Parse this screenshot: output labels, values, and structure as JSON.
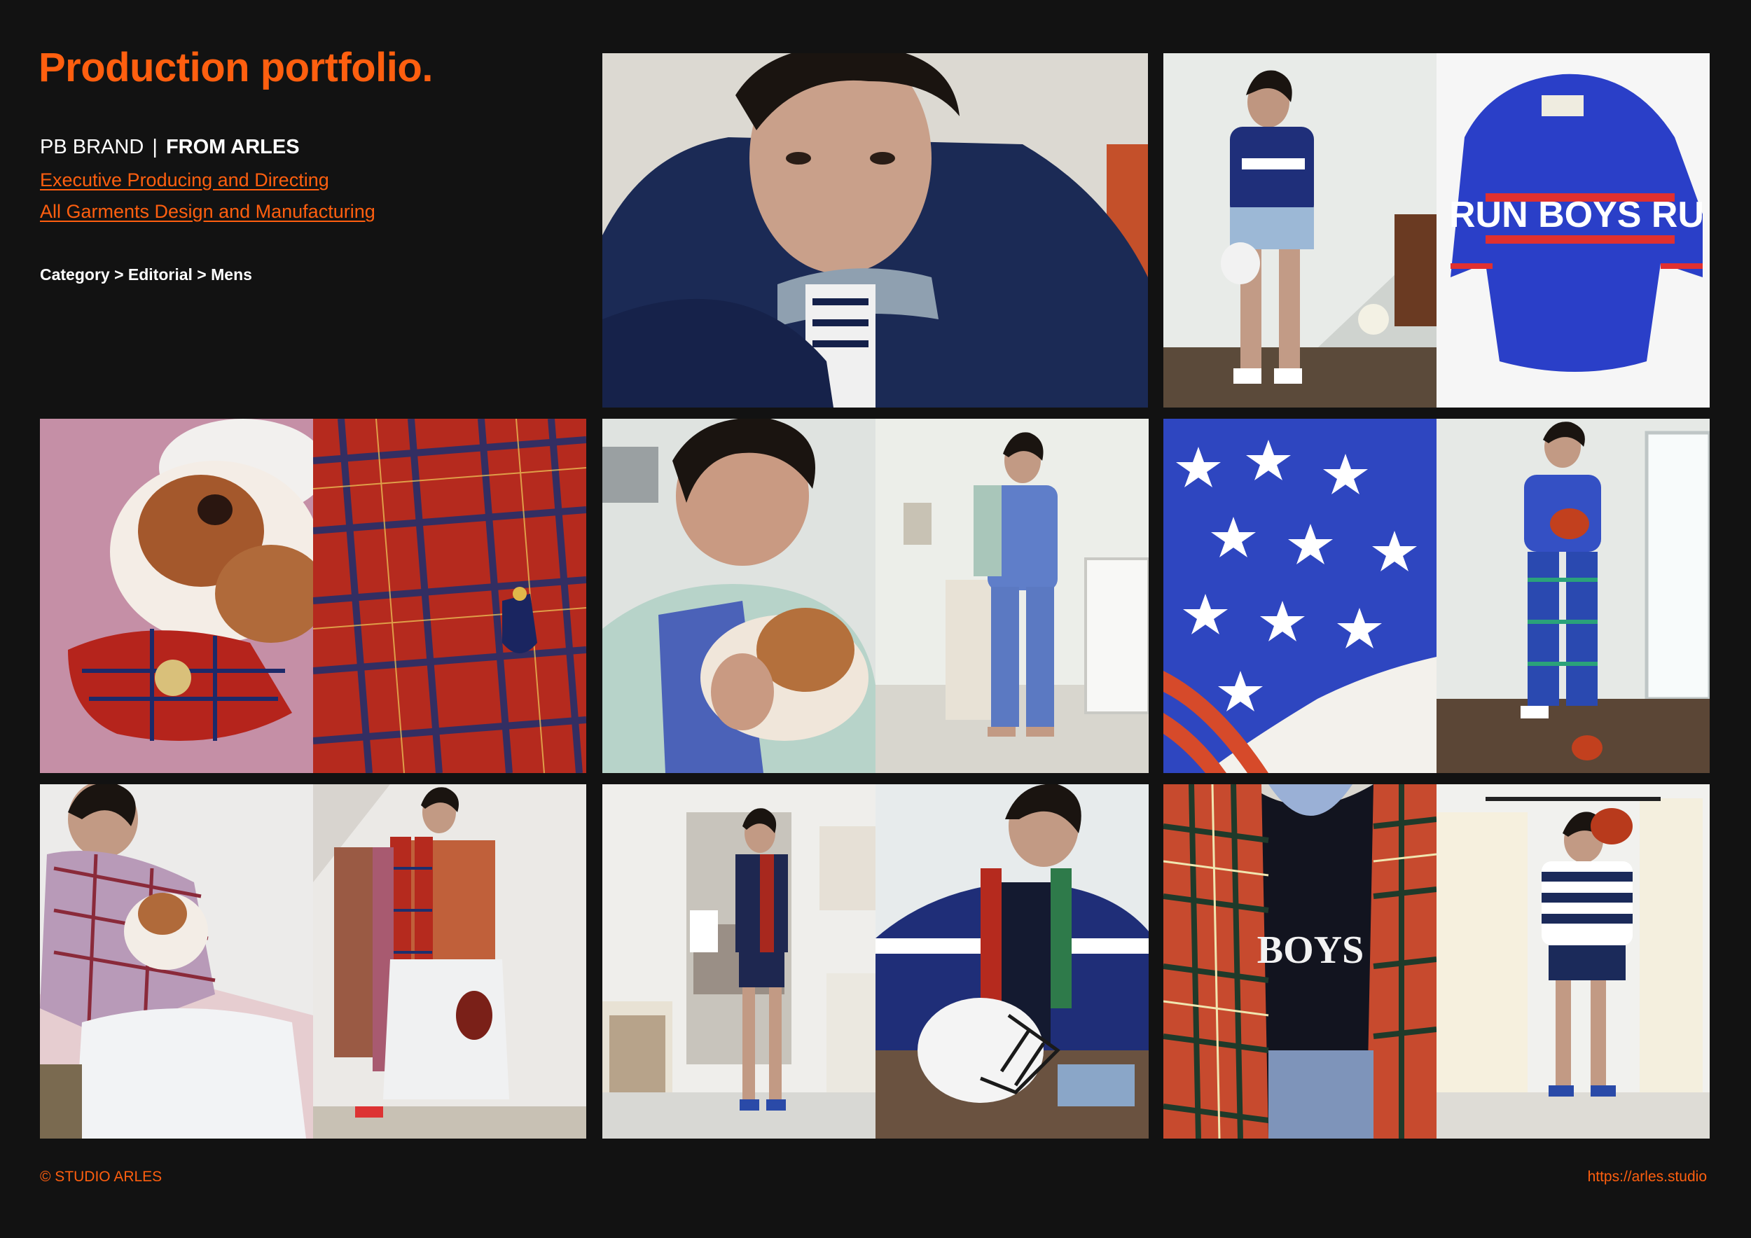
{
  "header": {
    "title": "Production portfolio."
  },
  "credits": {
    "client": "PB BRAND",
    "separator": "|",
    "project": "FROM ARLES",
    "roles": [
      "Executive Producing and Directing",
      "All Garments Design and Manufacturing"
    ],
    "breadcrumb": "Category > Editorial > Mens"
  },
  "gallery": {
    "photos": [
      {
        "subject": "portrait-navy-jacket"
      },
      {
        "subject": "hockey-jersey-full-look"
      },
      {
        "subject": "blue-sweater-flatlay",
        "visible_text": "RUN BOYS RU"
      },
      {
        "subject": "dog-tartan-scarf"
      },
      {
        "subject": "tartan-scarf-crest"
      },
      {
        "subject": "boy-with-dog-pajamas"
      },
      {
        "subject": "blue-pajamas-full-look"
      },
      {
        "subject": "stars-flag-fabric"
      },
      {
        "subject": "star-sweater-boxing-glove"
      },
      {
        "subject": "tartan-robe-with-dog"
      },
      {
        "subject": "tartan-scarf-white-trousers"
      },
      {
        "subject": "navy-blazer-doorway"
      },
      {
        "subject": "hockey-helmet-seated"
      },
      {
        "subject": "plaid-jacket-closeup",
        "visible_text": "BOYS"
      },
      {
        "subject": "rugby-stripe-boxing-glove"
      }
    ]
  },
  "footer": {
    "copyright": "© STUDIO ARLES",
    "url": "https://arles.studio"
  },
  "colors": {
    "background": "#121212",
    "accent": "#ff5f0f",
    "text": "#ffffff"
  }
}
